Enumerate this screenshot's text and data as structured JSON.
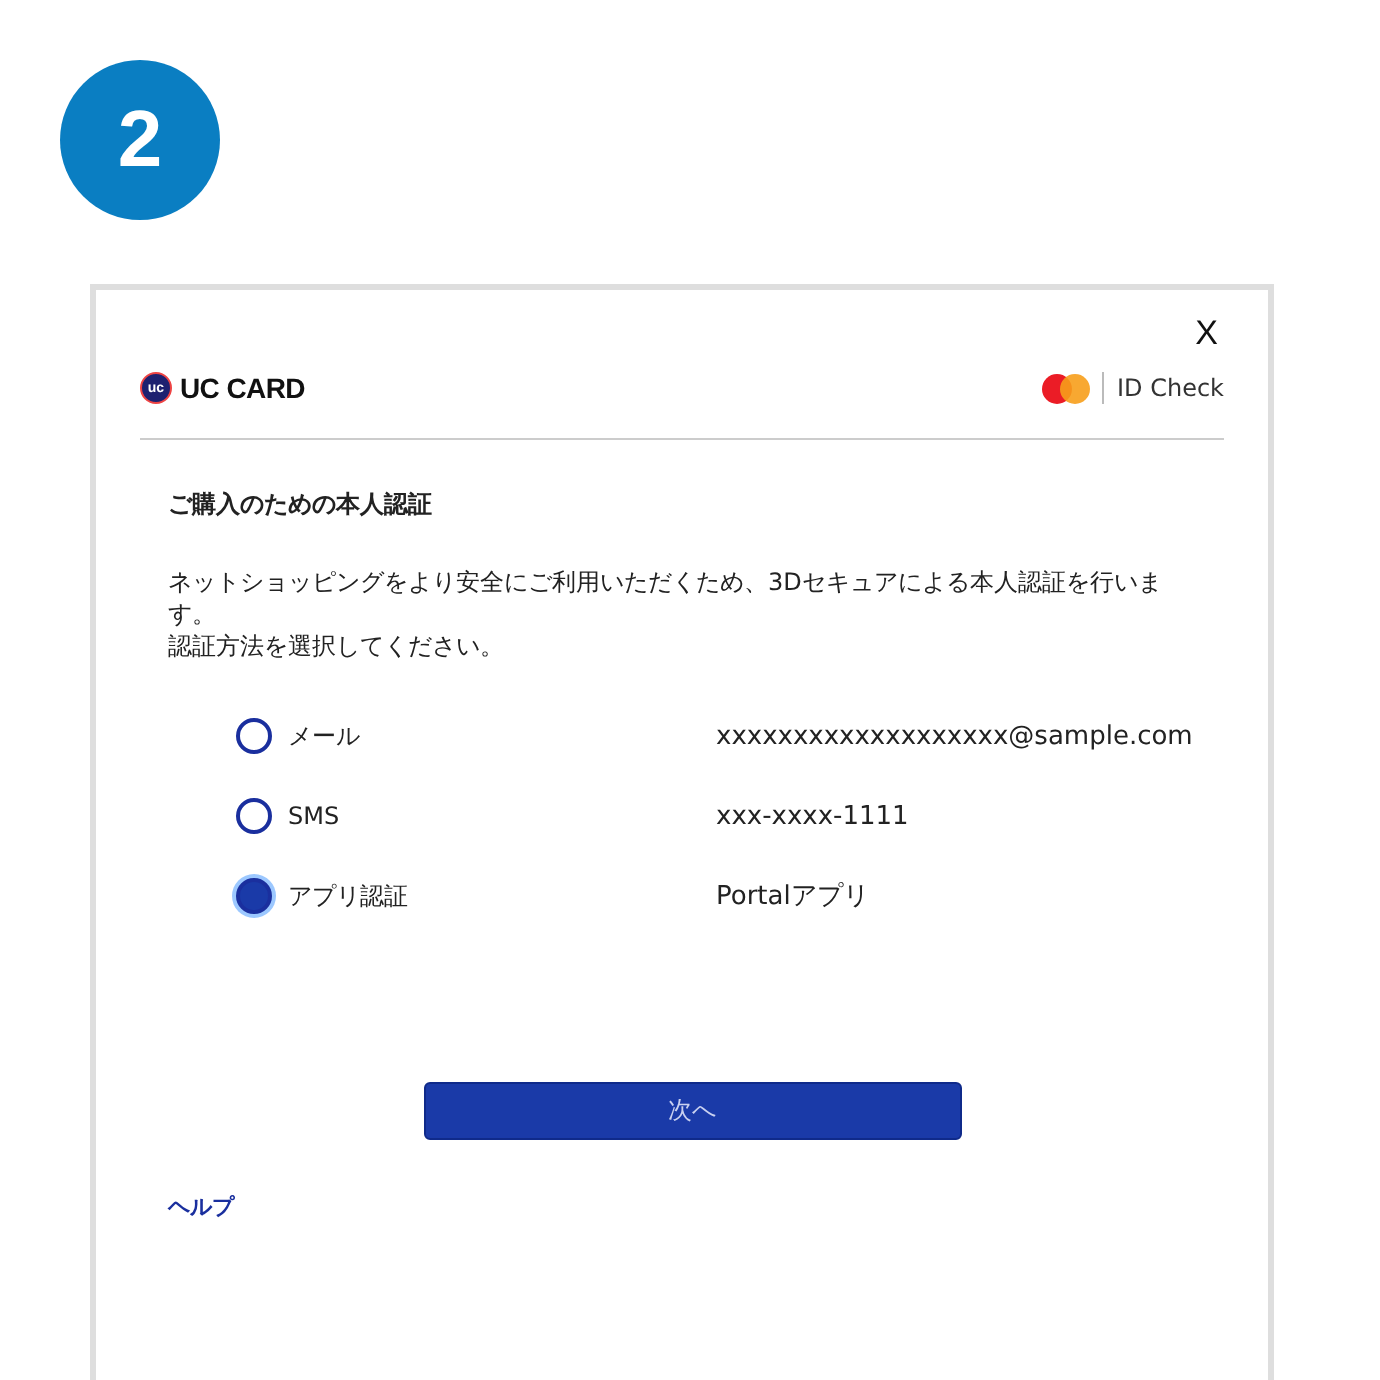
{
  "step": "2",
  "dialog": {
    "close": "X",
    "brand": {
      "mark": "uc",
      "name": "UC CARD"
    },
    "partner": "ID Check",
    "title": "ご購入のための本人認証",
    "message": "ネットショッピングをより安全にご利用いただくため、3Dセキュアによる本人認証を行います。",
    "instruction": "認証方法を選択してください。",
    "options": [
      {
        "label": "メール",
        "value": "xxxxxxxxxxxxxxxxxxx@sample.com",
        "selected": false
      },
      {
        "label": "SMS",
        "value": "xxx-xxxx-1111",
        "selected": false
      },
      {
        "label": "アプリ認証",
        "value": "Portalアプリ",
        "selected": true
      }
    ],
    "next_button": "次へ",
    "help_link": "ヘルプ"
  }
}
